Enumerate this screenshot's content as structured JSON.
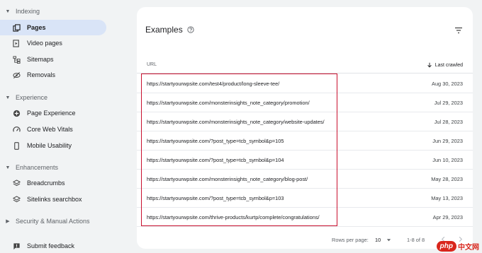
{
  "sidebar": {
    "sections": [
      {
        "label": "Indexing",
        "expanded": true
      },
      {
        "label": "Experience",
        "expanded": true
      },
      {
        "label": "Enhancements",
        "expanded": true
      },
      {
        "label": "Security & Manual Actions",
        "expanded": false
      }
    ],
    "items": [
      {
        "label": "Pages",
        "icon": "pages-icon",
        "active": true
      },
      {
        "label": "Video pages",
        "icon": "video-pages-icon",
        "active": false
      },
      {
        "label": "Sitemaps",
        "icon": "sitemaps-icon",
        "active": false
      },
      {
        "label": "Removals",
        "icon": "removals-icon",
        "active": false
      },
      {
        "label": "Page Experience",
        "icon": "page-experience-icon",
        "active": false
      },
      {
        "label": "Core Web Vitals",
        "icon": "core-web-vitals-icon",
        "active": false
      },
      {
        "label": "Mobile Usability",
        "icon": "mobile-usability-icon",
        "active": false
      },
      {
        "label": "Breadcrumbs",
        "icon": "breadcrumbs-icon",
        "active": false
      },
      {
        "label": "Sitelinks searchbox",
        "icon": "sitelinks-searchbox-icon",
        "active": false
      },
      {
        "label": "Submit feedback",
        "icon": "feedback-icon",
        "active": false
      }
    ]
  },
  "examples": {
    "title": "Examples",
    "col_url": "URL",
    "col_date": "Last crawled",
    "rows": [
      {
        "url": "https://startyourwpsite.com/test4/product/long-sleeve-tee/",
        "date": "Aug 30, 2023"
      },
      {
        "url": "https://startyourwpsite.com/monsterinsights_note_category/promotion/",
        "date": "Jul 29, 2023"
      },
      {
        "url": "https://startyourwpsite.com/monsterinsights_note_category/website-updates/",
        "date": "Jul 28, 2023"
      },
      {
        "url": "https://startyourwpsite.com/?post_type=tcb_symbol&p=105",
        "date": "Jun 29, 2023"
      },
      {
        "url": "https://startyourwpsite.com/?post_type=tcb_symbol&p=104",
        "date": "Jun 10, 2023"
      },
      {
        "url": "https://startyourwpsite.com/monsterinsights_note_category/blog-post/",
        "date": "May 28, 2023"
      },
      {
        "url": "https://startyourwpsite.com/?post_type=tcb_symbol&p=103",
        "date": "May 13, 2023"
      },
      {
        "url": "https://startyourwpsite.com/thrive-products/kurtp/complete/congratulations/",
        "date": "Apr 29, 2023"
      }
    ],
    "pagination": {
      "rows_per_page_label": "Rows per page:",
      "rows_per_page_value": "10",
      "range": "1-8 of 8"
    }
  },
  "watermark": {
    "logo": "php",
    "text": "中文网"
  },
  "colors": {
    "active_nav": "#d9e4f7",
    "highlight_border": "#c8102e"
  }
}
